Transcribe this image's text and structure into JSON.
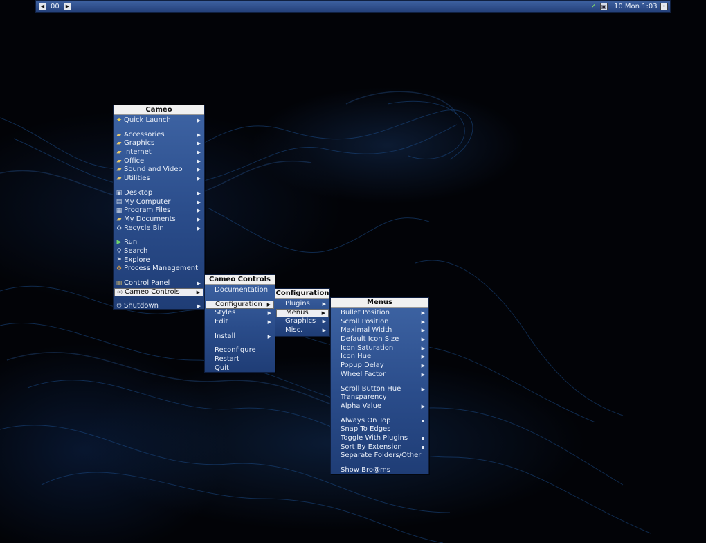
{
  "taskbar": {
    "workspace": "00",
    "prev_icon": "left-arrow-icon",
    "next_icon": "right-arrow-icon",
    "clock": "10 Mon 1:03",
    "tray": [
      "checkmark-icon",
      "network-icon",
      "menu-icon"
    ]
  },
  "main_menu": {
    "title": "Cameo",
    "items": [
      {
        "label": "Quick Launch",
        "icon": "star-icon",
        "submenu": true
      },
      {
        "sep": true
      },
      {
        "label": "Accessories",
        "icon": "folder-icon",
        "submenu": true
      },
      {
        "label": "Graphics",
        "icon": "folder-icon",
        "submenu": true
      },
      {
        "label": "Internet",
        "icon": "folder-icon",
        "submenu": true
      },
      {
        "label": "Office",
        "icon": "folder-icon",
        "submenu": true
      },
      {
        "label": "Sound and Video",
        "icon": "folder-icon",
        "submenu": true
      },
      {
        "label": "Utilities",
        "icon": "folder-icon",
        "submenu": true
      },
      {
        "sep": true
      },
      {
        "label": "Desktop",
        "icon": "desktop-icon",
        "submenu": true
      },
      {
        "label": "My Computer",
        "icon": "computer-icon",
        "submenu": true
      },
      {
        "label": "Program Files",
        "icon": "program-files-icon",
        "submenu": true
      },
      {
        "label": "My Documents",
        "icon": "folder-icon",
        "submenu": true
      },
      {
        "label": "Recycle Bin",
        "icon": "recycle-bin-icon",
        "submenu": true
      },
      {
        "sep": true
      },
      {
        "label": "Run",
        "icon": "run-icon",
        "submenu": false
      },
      {
        "label": "Search",
        "icon": "search-icon",
        "submenu": false
      },
      {
        "label": "Explore",
        "icon": "explore-icon",
        "submenu": false
      },
      {
        "label": "Process Management",
        "icon": "process-icon",
        "submenu": false
      },
      {
        "sep": true
      },
      {
        "label": "Control Panel",
        "icon": "control-panel-icon",
        "submenu": true
      },
      {
        "label": "Cameo Controls",
        "icon": "cameo-icon",
        "submenu": true,
        "selected": true
      },
      {
        "sep": true
      },
      {
        "label": "Shutdown",
        "icon": "power-icon",
        "submenu": true
      }
    ]
  },
  "controls_menu": {
    "title": "Cameo Controls",
    "items": [
      {
        "label": "Documentation",
        "submenu": false
      },
      {
        "sep": true
      },
      {
        "label": "Configuration",
        "submenu": true,
        "selected": true
      },
      {
        "label": "Styles",
        "submenu": true
      },
      {
        "label": "Edit",
        "submenu": true
      },
      {
        "sep": true
      },
      {
        "label": "Install",
        "submenu": true
      },
      {
        "sep": true
      },
      {
        "label": "Reconfigure",
        "submenu": false
      },
      {
        "label": "Restart",
        "submenu": false
      },
      {
        "label": "Quit",
        "submenu": false
      }
    ]
  },
  "config_menu": {
    "title": "Configuration",
    "items": [
      {
        "label": "Plugins",
        "submenu": true
      },
      {
        "label": "Menus",
        "submenu": true,
        "selected": true
      },
      {
        "label": "Graphics",
        "submenu": true
      },
      {
        "label": "Misc.",
        "submenu": true
      }
    ]
  },
  "menus_menu": {
    "title": "Menus",
    "items": [
      {
        "label": "Bullet Position",
        "submenu": true
      },
      {
        "label": "Scroll Position",
        "submenu": true
      },
      {
        "label": "Maximal Width",
        "submenu": true
      },
      {
        "label": "Default Icon Size",
        "submenu": true
      },
      {
        "label": "Icon Saturation",
        "submenu": true
      },
      {
        "label": "Icon Hue",
        "submenu": true
      },
      {
        "label": "Popup Delay",
        "submenu": true
      },
      {
        "label": "Wheel Factor",
        "submenu": true
      },
      {
        "sep": true
      },
      {
        "label": "Scroll Button Hue",
        "submenu": true
      },
      {
        "label": "Transparency",
        "submenu": false
      },
      {
        "label": "Alpha Value",
        "submenu": true
      },
      {
        "sep": true
      },
      {
        "label": "Always On Top",
        "submenu": false,
        "checked": true
      },
      {
        "label": "Snap To Edges",
        "submenu": false
      },
      {
        "label": "Toggle With Plugins",
        "submenu": false,
        "checked": true
      },
      {
        "label": "Sort By Extension",
        "submenu": false,
        "checked": true
      },
      {
        "label": "Separate Folders/Other",
        "submenu": false
      },
      {
        "sep": true
      },
      {
        "label": "Show Bro@ms",
        "submenu": false
      }
    ]
  }
}
